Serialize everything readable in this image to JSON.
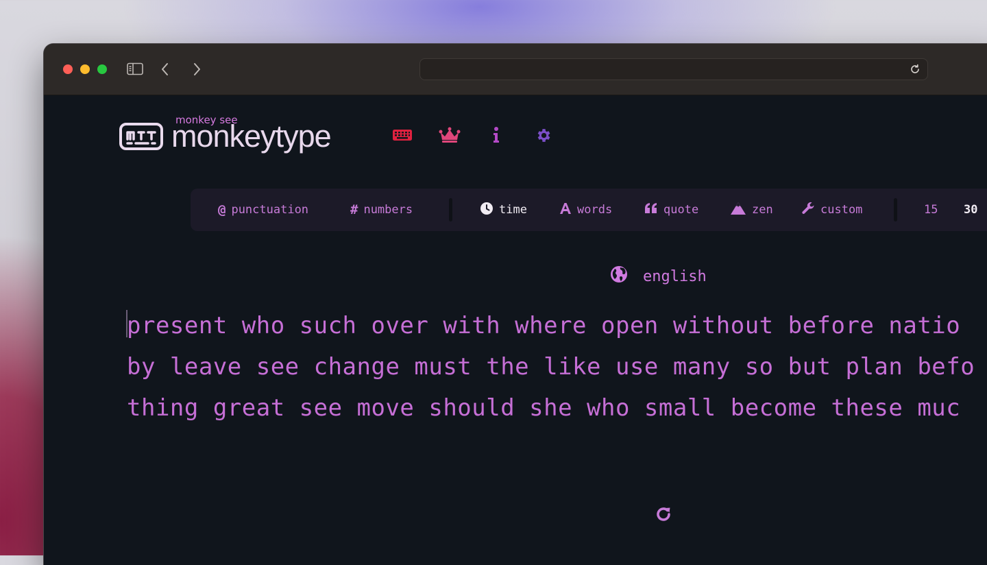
{
  "browser": {
    "address_text": ""
  },
  "brand": {
    "small_text": "monkey see",
    "name": "monkeytype"
  },
  "nav": {
    "items": [
      {
        "icon": "keyboard-icon",
        "color": "#e0213f"
      },
      {
        "icon": "crown-icon",
        "color": "#e0467b"
      },
      {
        "icon": "info-icon",
        "color": "#b44ac7"
      },
      {
        "icon": "gear-icon",
        "color": "#7b4fc7"
      }
    ]
  },
  "mode_bar": {
    "punctuation": "punctuation",
    "numbers": "numbers",
    "time": "time",
    "words": "words",
    "quote": "quote",
    "zen": "zen",
    "custom": "custom",
    "durations": [
      "15",
      "30"
    ],
    "active_mode": "time",
    "active_duration": "30"
  },
  "language": "english",
  "test": {
    "lines": [
      "present who such over with where open without before natio",
      "by leave see change must the like use many so but plan befo",
      "thing great see move should she who small become these muc"
    ]
  },
  "colors": {
    "accent": "#c66fd6",
    "background": "#10151c",
    "modebar_bg": "#1c1a28"
  }
}
